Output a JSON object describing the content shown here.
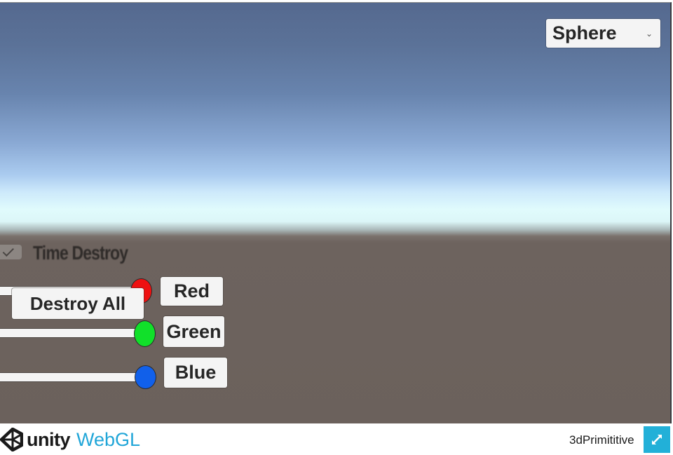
{
  "canvas": {
    "sky_top_color": "#55698f",
    "horizon_color": "#e0fbfc",
    "ground_color": "#6b615c"
  },
  "shape_dropdown": {
    "selected": "Sphere",
    "chevron_icon": "chevron-down-icon"
  },
  "time_destroy": {
    "label": "Time Destroy",
    "checked": true
  },
  "destroy_all": {
    "label": "Destroy All"
  },
  "color_sliders": [
    {
      "name": "red",
      "button_label": "Red",
      "value": 1.0,
      "knob_color": "#ee1111"
    },
    {
      "name": "green",
      "button_label": "Green",
      "value": 1.0,
      "knob_color": "#11e02a"
    },
    {
      "name": "blue",
      "button_label": "Blue",
      "value": 1.0,
      "knob_color": "#1160ea"
    }
  ],
  "footer": {
    "logo_word": "unity",
    "logo_suffix": "WebGL",
    "logo_suffix_color": "#21a6d8",
    "title": "3dPrimititive",
    "fullscreen_icon": "fullscreen-expand-icon",
    "fullscreen_color": "#22b0d8"
  }
}
